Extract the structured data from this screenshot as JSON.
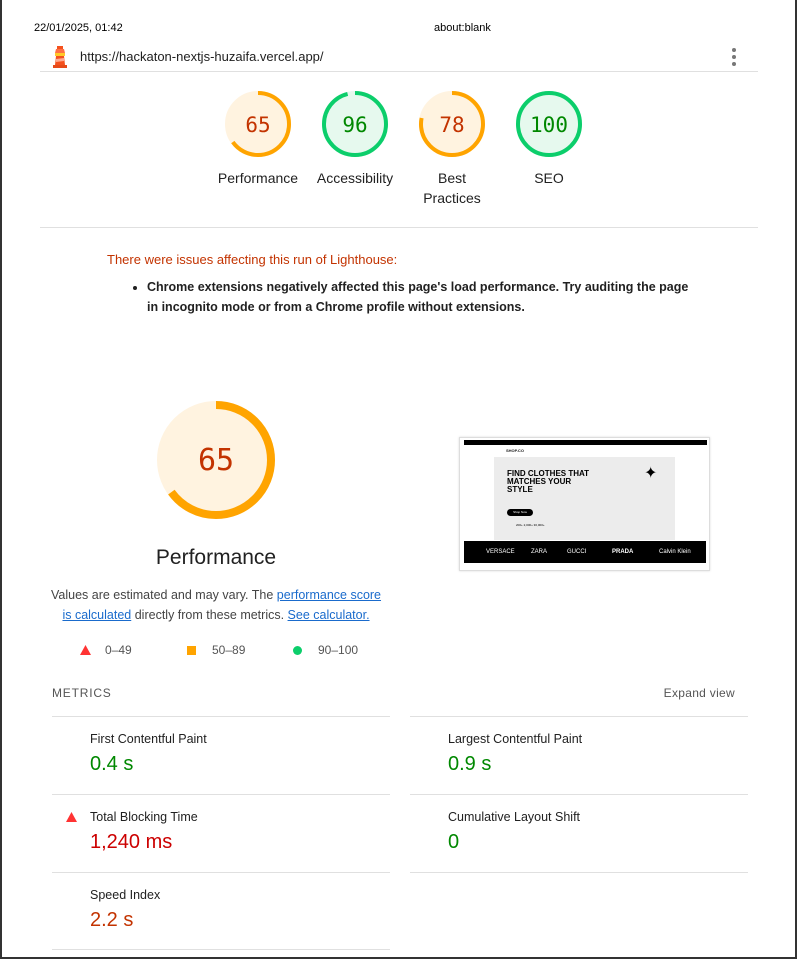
{
  "header": {
    "date": "22/01/2025, 01:42",
    "title": "about:blank"
  },
  "urlbar": {
    "url": "https://hackaton-nextjs-huzaifa.vercel.app/"
  },
  "gauges": [
    {
      "score": "65",
      "label": "Performance",
      "fraction": 0.65,
      "color": "#ffa400",
      "text_color": "#c33300",
      "fill": "#fff3e0"
    },
    {
      "score": "96",
      "label": "Accessibility",
      "fraction": 0.96,
      "color": "#0cce6b",
      "text_color": "#008800",
      "fill": "#e6f9ee"
    },
    {
      "score": "78",
      "label": "Best Practices",
      "fraction": 0.78,
      "color": "#ffa400",
      "text_color": "#c33300",
      "fill": "#fff3e0"
    },
    {
      "score": "100",
      "label": "SEO",
      "fraction": 1.0,
      "color": "#0cce6b",
      "text_color": "#008800",
      "fill": "#e6f9ee"
    }
  ],
  "warning": {
    "title": "There were issues affecting this run of Lighthouse:",
    "items": [
      "Chrome extensions negatively affected this page's load performance. Try auditing the page in incognito mode or from a Chrome profile without extensions."
    ]
  },
  "performance": {
    "score": "65",
    "fraction": 0.65,
    "title": "Performance",
    "desc_pre": "Values are estimated and may vary. The ",
    "desc_link1": "performance score is calculated",
    "desc_mid": " directly from these metrics. ",
    "desc_link2": "See calculator.",
    "legend": [
      {
        "range": "0–49",
        "color": "#ff3333",
        "shape": "triangle"
      },
      {
        "range": "50–89",
        "color": "#ffa400",
        "shape": "square"
      },
      {
        "range": "90–100",
        "color": "#0cce6b",
        "shape": "circle"
      }
    ]
  },
  "screenshot": {
    "logo": "SHOP.CO",
    "headline": "FIND CLOTHES THAT MATCHES YOUR STYLE",
    "cta": "Shop Now",
    "stats": "200+   2,000+   30,000+",
    "brands": [
      "VERSACE",
      "ZARA",
      "GUCCI",
      "PRADA",
      "Calvin Klein"
    ]
  },
  "metrics": {
    "heading": "METRICS",
    "expand": "Expand view",
    "items": [
      {
        "title": "First Contentful Paint",
        "value": "0.4 s",
        "status": "green"
      },
      {
        "title": "Largest Contentful Paint",
        "value": "0.9 s",
        "status": "green"
      },
      {
        "title": "Total Blocking Time",
        "value": "1,240 ms",
        "status": "red"
      },
      {
        "title": "Cumulative Layout Shift",
        "value": "0",
        "status": "green"
      },
      {
        "title": "Speed Index",
        "value": "2.2 s",
        "status": "orange"
      }
    ]
  }
}
